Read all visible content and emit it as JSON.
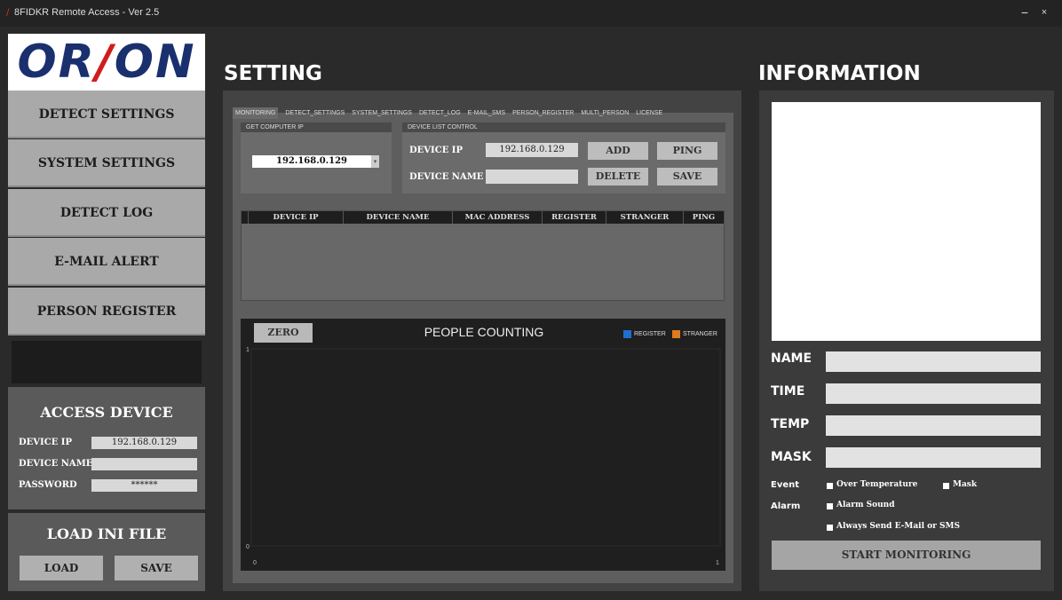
{
  "window": {
    "title": "8FIDKR Remote Access - Ver 2.5",
    "minimize": "−",
    "close": "×"
  },
  "logo": {
    "left": "OR",
    "slash": "/",
    "right": "ON"
  },
  "sidebar": {
    "items": [
      {
        "label": "DETECT SETTINGS"
      },
      {
        "label": "SYSTEM SETTINGS"
      },
      {
        "label": "DETECT LOG"
      },
      {
        "label": "E-MAIL ALERT"
      },
      {
        "label": "PERSON REGISTER"
      }
    ]
  },
  "access": {
    "title": "ACCESS DEVICE",
    "ip_label": "DEVICE IP",
    "ip_value": "192.168.0.129",
    "name_label": "DEVICE NAME",
    "name_value": "",
    "password_label": "PASSWORD",
    "password_value": "******"
  },
  "ini": {
    "title": "LOAD INI FILE",
    "load": "LOAD",
    "save": "SAVE"
  },
  "setting": {
    "title": "SETTING",
    "tabs": [
      {
        "label": "MONITORING"
      },
      {
        "label": "DETECT_SETTINGS"
      },
      {
        "label": "SYSTEM_SETTINGS"
      },
      {
        "label": "DETECT_LOG"
      },
      {
        "label": "E-MAIL_SMS"
      },
      {
        "label": "PERSON_REGISTER"
      },
      {
        "label": "MULTI_PERSON"
      },
      {
        "label": "LICENSE"
      }
    ],
    "get_ip": {
      "header": "GET COMPUTER IP",
      "value": "192.168.0.129",
      "arrow": "▾"
    },
    "device_list": {
      "header": "DEVICE LIST CONTROL",
      "ip_label": "DEVICE IP",
      "ip_value": "192.168.0.129",
      "name_label": "DEVICE NAME",
      "name_value": "",
      "add": "ADD",
      "ping": "PING",
      "delete": "DELETE",
      "save": "SAVE"
    },
    "table": {
      "columns": [
        "DEVICE IP",
        "DEVICE NAME",
        "MAC ADDRESS",
        "REGISTER",
        "STRANGER",
        "PING"
      ]
    },
    "counting": {
      "zero": "ZERO",
      "legend_register": "REGISTER",
      "legend_stranger": "STRANGER",
      "colors": {
        "register": "#1f6fd1",
        "stranger": "#e07a1f"
      }
    }
  },
  "chart_data": {
    "type": "line",
    "title": "PEOPLE COUNTING",
    "xlabel": "",
    "ylabel": "",
    "xlim": [
      0,
      1
    ],
    "ylim": [
      0,
      1
    ],
    "x_ticks": [
      "0",
      "1"
    ],
    "y_ticks": [
      "0",
      "1"
    ],
    "series": [
      {
        "name": "REGISTER",
        "values": []
      },
      {
        "name": "STRANGER",
        "values": []
      }
    ],
    "legend": "top-right",
    "grid": false
  },
  "info": {
    "title": "INFORMATION",
    "name_label": "NAME",
    "time_label": "TIME",
    "temp_label": "TEMP",
    "mask_label": "MASK",
    "name_value": "",
    "time_value": "",
    "temp_value": "",
    "mask_value": "",
    "event_label": "Event",
    "alarm_label": "Alarm",
    "over_temp": "Over Temperature",
    "mask_check": "Mask",
    "alarm_sound": "Alarm Sound",
    "always_send": "Always Send E-Mail or SMS",
    "start": "START MONITORING"
  }
}
